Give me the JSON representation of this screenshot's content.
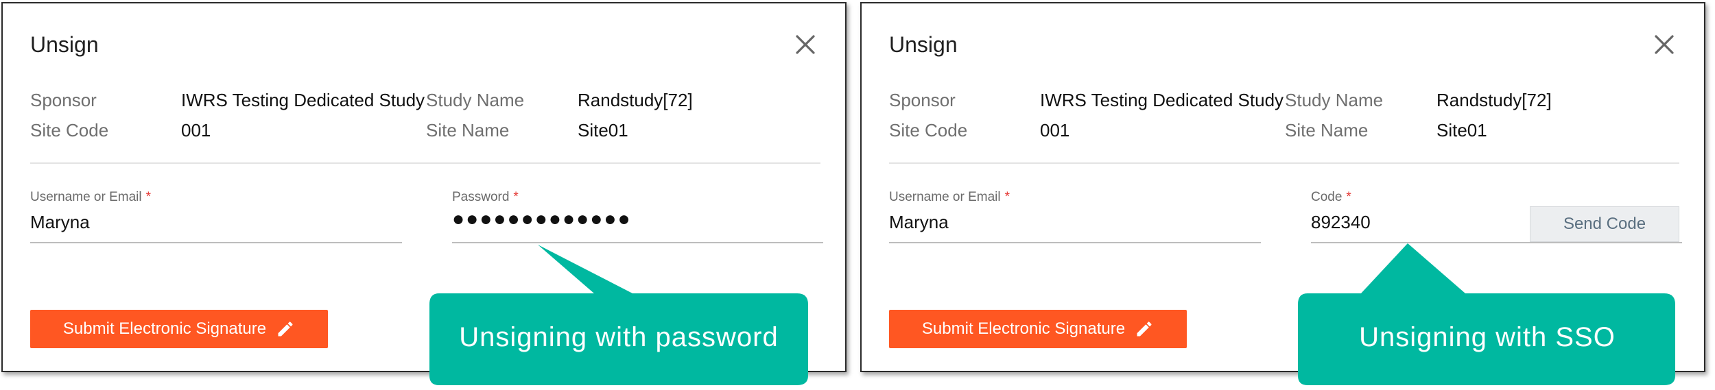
{
  "panels": [
    {
      "title": "Unsign",
      "info": {
        "sponsor_label": "Sponsor",
        "sponsor_value": "IWRS Testing Dedicated Study",
        "study_name_label": "Study Name",
        "study_name_value": "Randstudy[72]",
        "site_code_label": "Site Code",
        "site_code_value": "001",
        "site_name_label": "Site Name",
        "site_name_value": "Site01"
      },
      "username": {
        "label": "Username or Email",
        "value": "Maryna"
      },
      "secret": {
        "label": "Password",
        "value": "●●●●●●●●●●●●●"
      },
      "submit_label": "Submit Electronic Signature",
      "callout": "Unsigning with password"
    },
    {
      "title": "Unsign",
      "info": {
        "sponsor_label": "Sponsor",
        "sponsor_value": "IWRS Testing Dedicated Study",
        "study_name_label": "Study Name",
        "study_name_value": "Randstudy[72]",
        "site_code_label": "Site Code",
        "site_code_value": "001",
        "site_name_label": "Site Name",
        "site_name_value": "Site01"
      },
      "username": {
        "label": "Username or Email",
        "value": "Maryna"
      },
      "secret": {
        "label": "Code",
        "value": "892340"
      },
      "send_code_label": "Send Code",
      "submit_label": "Submit Electronic Signature",
      "callout": "Unsigning with SSO"
    }
  ],
  "required_marker": "*",
  "colors": {
    "submit_button": "#ff5722",
    "callout": "#00b8a0",
    "required": "#e53935"
  },
  "icons": [
    "close-icon",
    "pencil-icon"
  ]
}
